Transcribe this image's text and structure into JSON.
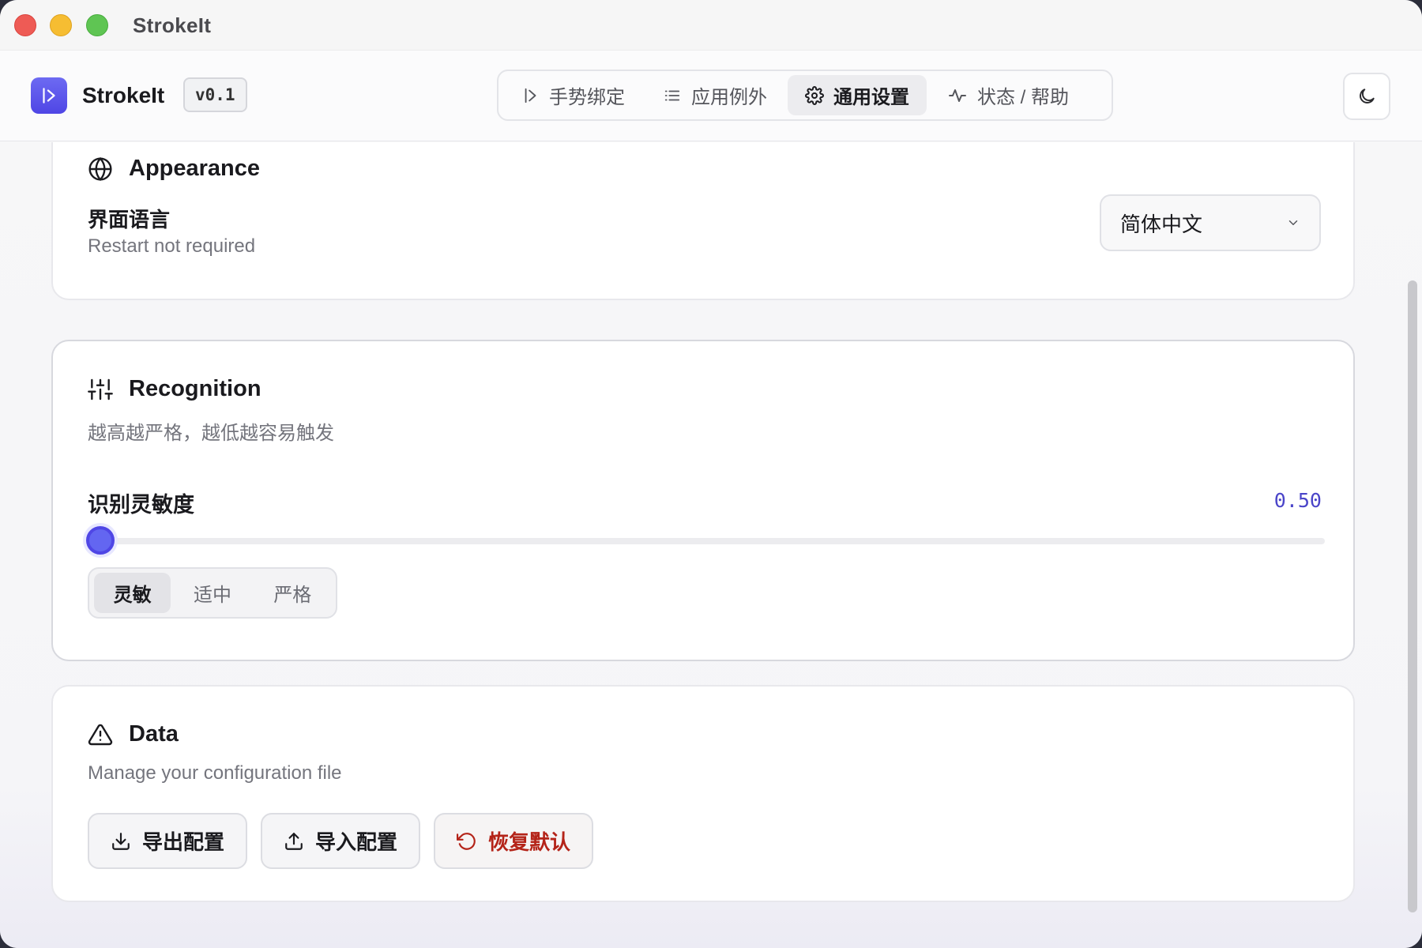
{
  "window": {
    "title": "StrokeIt"
  },
  "header": {
    "app_name": "StrokeIt",
    "version": "v0.1",
    "logo_icon": "arrow-right-to-line-icon",
    "theme_icon": "moon-icon",
    "tabs": [
      {
        "label": "手势绑定",
        "icon": "gesture-arrow-icon",
        "active": false
      },
      {
        "label": "应用例外",
        "icon": "list-icon",
        "active": false
      },
      {
        "label": "通用设置",
        "icon": "gear-icon",
        "active": true
      },
      {
        "label": "状态 / 帮助",
        "icon": "activity-icon",
        "active": false
      }
    ]
  },
  "appearance": {
    "title": "Appearance",
    "icon": "globe-icon",
    "language_label": "界面语言",
    "language_sub": "Restart not required",
    "language_value": "简体中文"
  },
  "recognition": {
    "title": "Recognition",
    "icon": "sliders-icon",
    "description": "越高越严格，越低越容易触发",
    "sensitivity_label": "识别灵敏度",
    "sensitivity_value": "0.50",
    "slider_fraction": 0.0,
    "presets": [
      {
        "label": "灵敏",
        "active": true
      },
      {
        "label": "适中",
        "active": false
      },
      {
        "label": "严格",
        "active": false
      }
    ]
  },
  "data_section": {
    "title": "Data",
    "icon": "warning-triangle-icon",
    "description": "Manage your configuration file",
    "export_label": "导出配置",
    "import_label": "导入配置",
    "reset_label": "恢复默认"
  },
  "colors": {
    "accent": "#6366f1",
    "danger": "#b42318"
  }
}
